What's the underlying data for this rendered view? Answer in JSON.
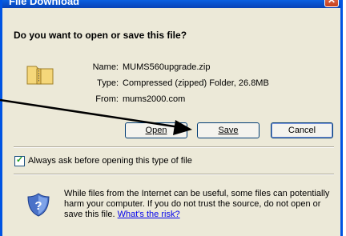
{
  "window": {
    "title": "File Download",
    "close_glyph": "✕"
  },
  "prompt": {
    "question": "Do you want to open or save this file?"
  },
  "file_info": {
    "name_label": "Name:",
    "name_value": "MUMS560upgrade.zip",
    "type_label": "Type:",
    "type_value": "Compressed (zipped) Folder, 26.8MB",
    "from_label": "From:",
    "from_value": "mums2000.com"
  },
  "buttons": {
    "open": "Open",
    "save": "Save",
    "cancel": "Cancel"
  },
  "checkbox": {
    "label": "Always ask before opening this type of file",
    "checked": true
  },
  "warning": {
    "text": "While files from the Internet can be useful, some files can potentially harm your computer. If you do not trust the source, do not open or save this file.",
    "link": "What's the risk?"
  },
  "icons": {
    "file": "zip-folder-icon",
    "shield": "security-shield-icon",
    "arrow": "pointer-arrow-icon"
  },
  "colors": {
    "title_bar": "#0a5fe0",
    "dialog_bg": "#ece9d8",
    "link": "#0000ee"
  }
}
